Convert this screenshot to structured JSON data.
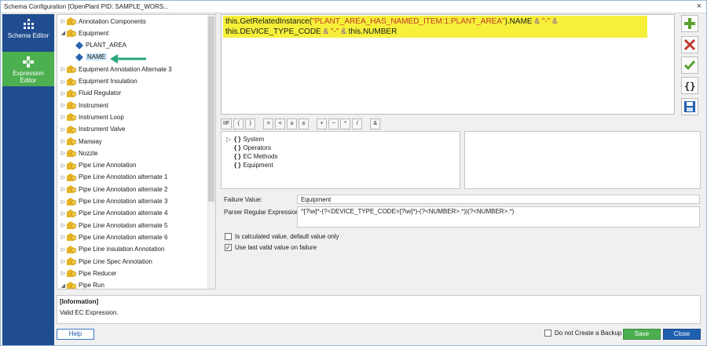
{
  "window": {
    "title": "Schema Configuration [OpenPlant PID: SAMPLE_WORS...",
    "close_glyph": "×"
  },
  "nav": [
    {
      "label_line1": "Schema Editor",
      "label_line2": "",
      "icon": "schema-icon"
    },
    {
      "label_line1": "Expression",
      "label_line2": "Editor",
      "icon": "expression-icon"
    }
  ],
  "tree": {
    "items": [
      {
        "label": "Annotation Components",
        "level": 0,
        "expander": "▷",
        "kind": "class"
      },
      {
        "label": "Equipment",
        "level": 0,
        "expander": "◢",
        "kind": "class"
      },
      {
        "label": "PLANT_AREA",
        "level": 1,
        "expander": "",
        "kind": "property"
      },
      {
        "label": "NAME",
        "level": 1,
        "expander": "",
        "kind": "property",
        "selected": true
      },
      {
        "label": "Equipment Annotation Alternate 3",
        "level": 0,
        "expander": "▷",
        "kind": "class"
      },
      {
        "label": "Equipment Insulation",
        "level": 0,
        "expander": "▷",
        "kind": "class"
      },
      {
        "label": "Fluid Regulator",
        "level": 0,
        "expander": "▷",
        "kind": "class"
      },
      {
        "label": "Instrument",
        "level": 0,
        "expander": "▷",
        "kind": "class"
      },
      {
        "label": "Instrument Loop",
        "level": 0,
        "expander": "▷",
        "kind": "class"
      },
      {
        "label": "Instrument Valve",
        "level": 0,
        "expander": "▷",
        "kind": "class"
      },
      {
        "label": "Manway",
        "level": 0,
        "expander": "▷",
        "kind": "class"
      },
      {
        "label": "Nozzle",
        "level": 0,
        "expander": "▷",
        "kind": "class"
      },
      {
        "label": "Pipe Line Annotation",
        "level": 0,
        "expander": "▷",
        "kind": "class"
      },
      {
        "label": "Pipe Line Annotation alternate 1",
        "level": 0,
        "expander": "▷",
        "kind": "class"
      },
      {
        "label": "Pipe Line Annotation alternate 2",
        "level": 0,
        "expander": "▷",
        "kind": "class"
      },
      {
        "label": "Pipe Line Annotation alternate 3",
        "level": 0,
        "expander": "▷",
        "kind": "class"
      },
      {
        "label": "Pipe Line Annotation alternate 4",
        "level": 0,
        "expander": "▷",
        "kind": "class"
      },
      {
        "label": "Pipe Line Annotation alternate 5",
        "level": 0,
        "expander": "▷",
        "kind": "class"
      },
      {
        "label": "Pipe Line Annotation alternate 6",
        "level": 0,
        "expander": "▷",
        "kind": "class"
      },
      {
        "label": "Pipe Line insulation Annotation",
        "level": 0,
        "expander": "▷",
        "kind": "class"
      },
      {
        "label": "Pipe Line Spec Annotation",
        "level": 0,
        "expander": "▷",
        "kind": "class"
      },
      {
        "label": "Pipe Reducer",
        "level": 0,
        "expander": "▷",
        "kind": "class"
      },
      {
        "label": "Pipe Run",
        "level": 0,
        "expander": "◢",
        "kind": "class"
      }
    ]
  },
  "expression": {
    "parts": [
      {
        "text": "this.GetRelatedInstance(",
        "style": "blue"
      },
      {
        "text": "\"PLANT_AREA_HAS_NAMED_ITEM:1:PLANT_AREA\"",
        "style": "red"
      },
      {
        "text": ").NAME ",
        "style": "blue"
      },
      {
        "text": "& ",
        "style": "op"
      },
      {
        "text": "\"-\"",
        "style": "red"
      },
      {
        "text": " & ",
        "style": "op"
      },
      {
        "text": "this.DEVICE_TYPE_CODE ",
        "style": "blue"
      },
      {
        "text": "& ",
        "style": "op"
      },
      {
        "text": "\"-\"",
        "style": "red"
      },
      {
        "text": " & ",
        "style": "op"
      },
      {
        "text": "this.NUMBER",
        "style": "blue"
      }
    ]
  },
  "toolbar_right": [
    {
      "name": "add-button",
      "icon": "plus-icon"
    },
    {
      "name": "delete-button",
      "icon": "x-icon"
    },
    {
      "name": "validate-button",
      "icon": "check-icon"
    },
    {
      "name": "braces-button",
      "icon": "braces-icon"
    },
    {
      "name": "save-expression-button",
      "icon": "floppy-icon"
    }
  ],
  "operators": [
    "IIF",
    "(",
    ")",
    "",
    ">",
    "<",
    "≥",
    "≤",
    "",
    "+",
    "−",
    "*",
    "/",
    "",
    "&"
  ],
  "functions": {
    "items": [
      {
        "label": "System",
        "expander": "▷"
      },
      {
        "label": "Operators",
        "expander": ""
      },
      {
        "label": "EC Methods",
        "expander": ""
      },
      {
        "label": "Equipment",
        "expander": ""
      }
    ],
    "brace_glyph": "{ }"
  },
  "form": {
    "failure_label": "Failure Value:",
    "failure_value": "Equipment",
    "regex_label": "Parser Regular Expression:",
    "regex_value": "^[?\\w]*-(?<DEVICE_TYPE_CODE>[?\\w]*)-(?<NUMBER>.*)|(?<NUMBER>.*)",
    "calc_label": "Is calculated value, default value only",
    "calc_checked": false,
    "last_valid_label": "Use last valid value on failure",
    "last_valid_checked": true
  },
  "info": {
    "heading": "[Information]",
    "message": "Valid EC Expression."
  },
  "footer": {
    "help_label": "Help",
    "backup_label": "Do not Create a Backup",
    "backup_checked": false,
    "save_label": "Save",
    "close_label": "Close"
  },
  "colors": {
    "nav_bg": "#1f4d8f",
    "nav_active": "#4caf50",
    "highlight": "#f7f03a",
    "arrow": "#2aa87a"
  }
}
